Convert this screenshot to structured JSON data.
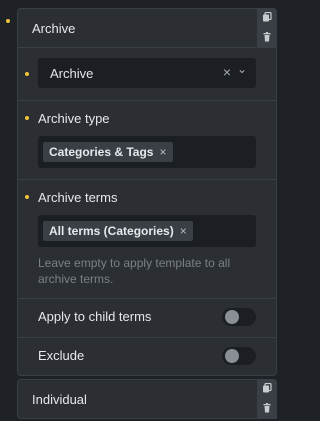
{
  "archive_panel": {
    "title": "Archive",
    "archive_select": {
      "value": "Archive",
      "clear_glyph": "×",
      "chevron_glyph": "⌄"
    },
    "archive_type": {
      "label": "Archive type",
      "selected": [
        {
          "label": "Categories & Tags",
          "remove_glyph": "×"
        }
      ]
    },
    "archive_terms": {
      "label": "Archive terms",
      "selected": [
        {
          "label": "All terms (Categories)",
          "remove_glyph": "×"
        }
      ],
      "help_line1": "Leave empty to apply template to all",
      "help_line2": "archive terms."
    },
    "apply_to_child_terms": {
      "label": "Apply to child terms",
      "enabled": false
    },
    "exclude": {
      "label": "Exclude",
      "enabled": false
    },
    "accent_color": "#f0c23a"
  },
  "individual_panel": {
    "title": "Individual"
  },
  "icons": {
    "copy": "copy-icon",
    "delete": "trash-icon"
  }
}
